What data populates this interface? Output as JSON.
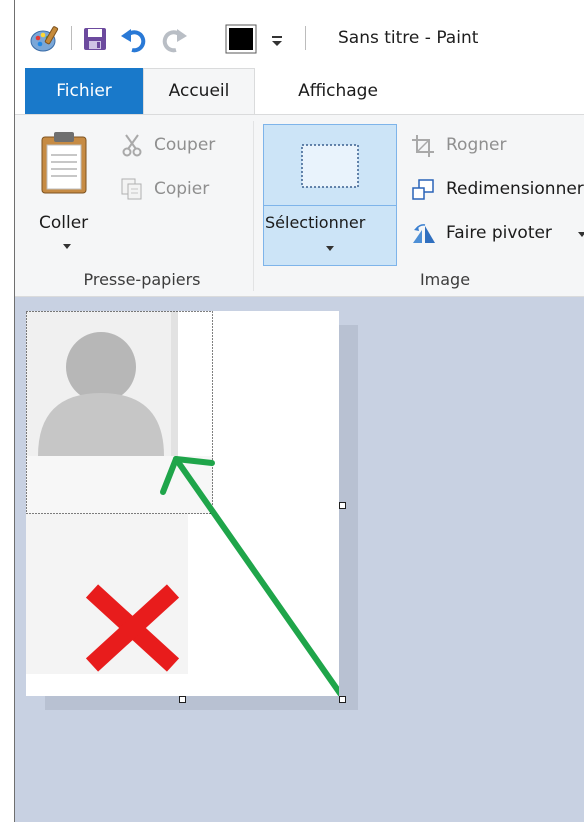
{
  "window": {
    "title": "Sans titre - Paint"
  },
  "quick_access": {
    "icons": [
      "paint-app-icon",
      "save-icon",
      "undo-icon",
      "redo-icon",
      "color-swatch-icon",
      "customize-qat-icon"
    ],
    "color_value": "#000000"
  },
  "tabs": [
    {
      "label": "Fichier",
      "active": false,
      "accent": "#1979ca"
    },
    {
      "label": "Accueil",
      "active": true
    },
    {
      "label": "Affichage",
      "active": false
    }
  ],
  "ribbon": {
    "clipboard": {
      "group_label": "Presse-papiers",
      "paste_label": "Coller",
      "cut_label": "Couper",
      "copy_label": "Copier"
    },
    "image": {
      "group_label": "Image",
      "select_label": "Sélectionner",
      "crop_label": "Rogner",
      "resize_label": "Redimensionner",
      "rotate_label": "Faire pivoter"
    }
  },
  "canvas": {
    "background": "#ffffff",
    "workspace_color": "#c8d1e2",
    "content": {
      "avatar_placeholder": "person-silhouette",
      "cross_mark_color": "#e81c1c",
      "arrow_color": "#1fa54a"
    }
  }
}
